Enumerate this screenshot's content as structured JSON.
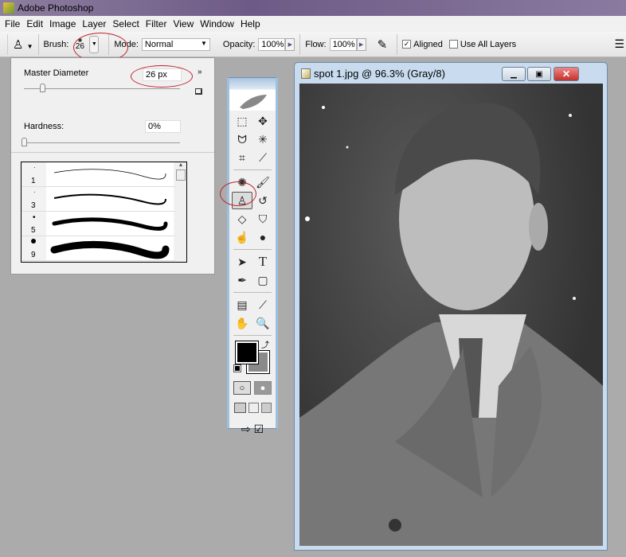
{
  "app": {
    "title": "Adobe Photoshop"
  },
  "menu": [
    "File",
    "Edit",
    "Image",
    "Layer",
    "Select",
    "Filter",
    "View",
    "Window",
    "Help"
  ],
  "options": {
    "brush_label": "Brush:",
    "brush_size": "26",
    "mode_label": "Mode:",
    "mode_value": "Normal",
    "opacity_label": "Opacity:",
    "opacity_value": "100%",
    "flow_label": "Flow:",
    "flow_value": "100%",
    "aligned_label": "Aligned",
    "aligned_checked": true,
    "use_all_layers_label": "Use All Layers",
    "use_all_layers_checked": false
  },
  "brush_panel": {
    "master_diameter_label": "Master Diameter",
    "master_diameter_value": "26 px",
    "hardness_label": "Hardness:",
    "hardness_value": "0%",
    "presets": [
      {
        "size": "1"
      },
      {
        "size": "3"
      },
      {
        "size": "5"
      },
      {
        "size": "9"
      }
    ]
  },
  "document": {
    "title": "spot 1.jpg @ 96.3% (Gray/8)"
  },
  "toolbox": {
    "selected_tool": "clone-stamp-tool"
  },
  "colors": {
    "accent_red": "#c3222a",
    "foreground": "#000000",
    "background": "#8a8a8a"
  }
}
